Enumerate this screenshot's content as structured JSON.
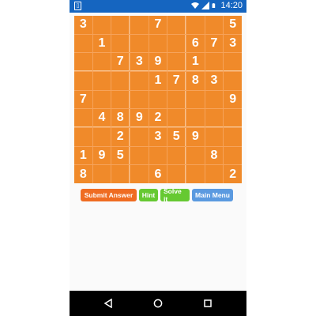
{
  "status_bar": {
    "time": "14:20"
  },
  "board": [
    [
      "3",
      "",
      "",
      "",
      "7",
      "",
      "",
      "",
      "5"
    ],
    [
      "",
      "1",
      "",
      "",
      "",
      "",
      "6",
      "7",
      "3"
    ],
    [
      "",
      "",
      "7",
      "3",
      "9",
      "",
      "1",
      "",
      ""
    ],
    [
      "",
      "",
      "",
      "",
      "1",
      "7",
      "8",
      "3",
      ""
    ],
    [
      "7",
      "",
      "",
      "",
      "",
      "",
      "",
      "",
      "9"
    ],
    [
      "",
      "4",
      "8",
      "9",
      "2",
      "",
      "",
      "",
      ""
    ],
    [
      "",
      "",
      "2",
      "",
      "3",
      "5",
      "9",
      "",
      ""
    ],
    [
      "1",
      "9",
      "5",
      "",
      "",
      "",
      "",
      "8",
      ""
    ],
    [
      "8",
      "",
      "",
      "",
      "6",
      "",
      "",
      "",
      "2"
    ]
  ],
  "buttons": {
    "submit": "Submit Answer",
    "hint": "Hint",
    "solve": "Solve it",
    "menu": "Main Menu"
  },
  "colors": {
    "status_bar": "#1565c0",
    "cell": "#f08a2a",
    "submit": "#ef6c22",
    "hint": "#66c932",
    "menu": "#5b9ae0"
  },
  "icons": {
    "status_left": "sim-card-icon",
    "wifi": "wifi-icon",
    "signal": "signal-icon",
    "battery": "battery-icon",
    "back": "back-icon",
    "home": "home-icon",
    "recents": "recents-icon"
  }
}
